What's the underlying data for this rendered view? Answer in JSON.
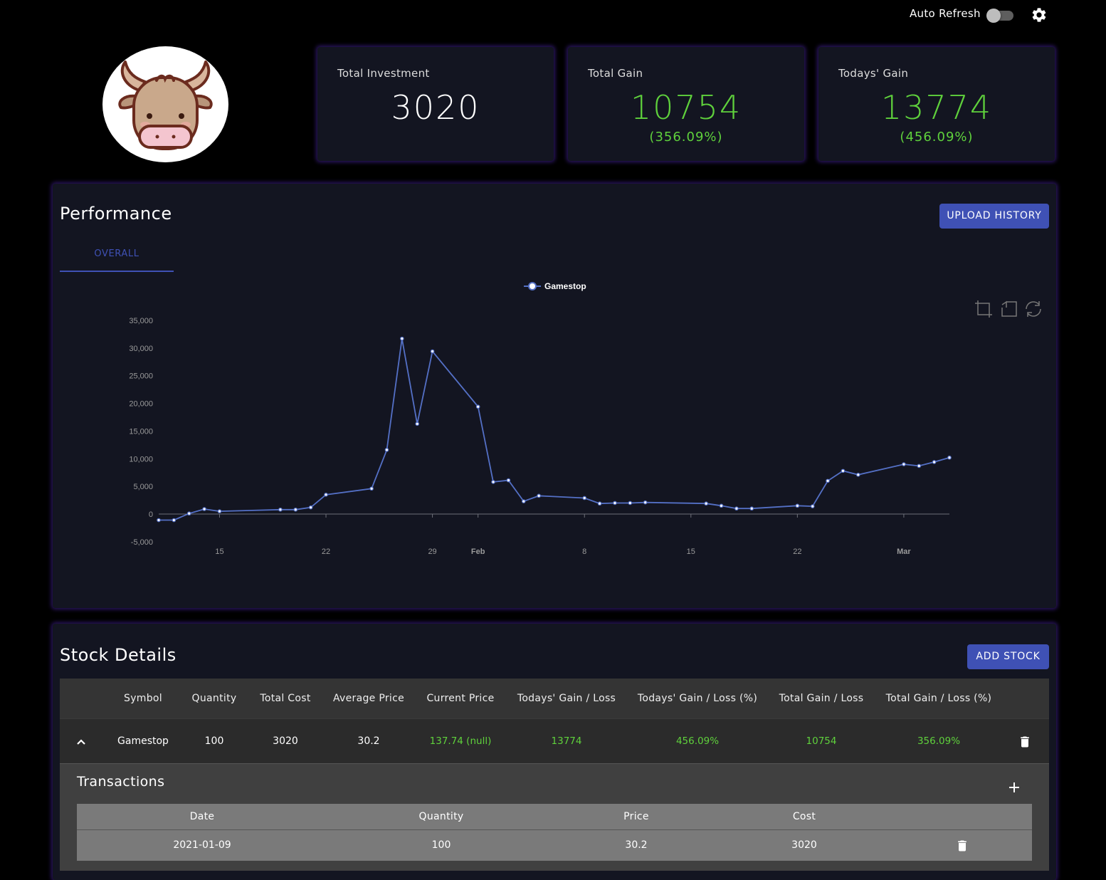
{
  "header": {
    "auto_refresh_label": "Auto Refresh",
    "auto_refresh_on": false,
    "settings_icon": "gear-icon"
  },
  "avatar": {
    "icon": "bull-icon"
  },
  "stats": {
    "total_investment": {
      "title": "Total Investment",
      "value": "3020"
    },
    "total_gain": {
      "title": "Total Gain",
      "value": "10754",
      "percent": "(356.09%)"
    },
    "todays_gain": {
      "title": "Todays' Gain",
      "value": "13774",
      "percent": "(456.09%)"
    }
  },
  "performance": {
    "title": "Performance",
    "upload_button": "UPLOAD HISTORY",
    "tabs": [
      {
        "label": "OVERALL",
        "active": true
      }
    ],
    "toolbar_icons": [
      "zoom-icon",
      "reset-zoom-icon",
      "refresh-icon"
    ]
  },
  "chart_data": {
    "type": "line",
    "series": [
      {
        "name": "Gamestop",
        "color": "#5470c6",
        "points": [
          [
            "2021-01-11",
            -1100
          ],
          [
            "2021-01-12",
            -1100
          ],
          [
            "2021-01-13",
            100
          ],
          [
            "2021-01-14",
            900
          ],
          [
            "2021-01-15",
            500
          ],
          [
            "2021-01-19",
            800
          ],
          [
            "2021-01-20",
            800
          ],
          [
            "2021-01-21",
            1200
          ],
          [
            "2021-01-22",
            3500
          ],
          [
            "2021-01-25",
            4600
          ],
          [
            "2021-01-26",
            11600
          ],
          [
            "2021-01-27",
            31700
          ],
          [
            "2021-01-28",
            16300
          ],
          [
            "2021-01-29",
            29400
          ],
          [
            "2021-02-01",
            19400
          ],
          [
            "2021-02-02",
            5800
          ],
          [
            "2021-02-03",
            6100
          ],
          [
            "2021-02-04",
            2300
          ],
          [
            "2021-02-05",
            3300
          ],
          [
            "2021-02-08",
            2900
          ],
          [
            "2021-02-09",
            1900
          ],
          [
            "2021-02-10",
            2000
          ],
          [
            "2021-02-11",
            2000
          ],
          [
            "2021-02-12",
            2100
          ],
          [
            "2021-02-16",
            1900
          ],
          [
            "2021-02-17",
            1500
          ],
          [
            "2021-02-18",
            1000
          ],
          [
            "2021-02-19",
            1000
          ],
          [
            "2021-02-22",
            1500
          ],
          [
            "2021-02-23",
            1400
          ],
          [
            "2021-02-24",
            6000
          ],
          [
            "2021-02-25",
            7800
          ],
          [
            "2021-02-26",
            7100
          ],
          [
            "2021-03-01",
            9000
          ],
          [
            "2021-03-02",
            8700
          ],
          [
            "2021-03-03",
            9400
          ],
          [
            "2021-03-04",
            10200
          ]
        ]
      }
    ],
    "xlabel": "",
    "ylabel": "",
    "ylim": [
      -5000,
      35000
    ],
    "y_ticks": [
      "35,000",
      "30,000",
      "25,000",
      "20,000",
      "15,000",
      "10,000",
      "5,000",
      "0",
      "-5,000"
    ],
    "x_ticks": [
      {
        "date": "2021-01-15",
        "label": "15",
        "bold": false
      },
      {
        "date": "2021-01-22",
        "label": "22",
        "bold": false
      },
      {
        "date": "2021-01-29",
        "label": "29",
        "bold": false
      },
      {
        "date": "2021-02-01",
        "label": "Feb",
        "bold": true
      },
      {
        "date": "2021-02-08",
        "label": "8",
        "bold": false
      },
      {
        "date": "2021-02-15",
        "label": "15",
        "bold": false
      },
      {
        "date": "2021-02-22",
        "label": "22",
        "bold": false
      },
      {
        "date": "2021-03-01",
        "label": "Mar",
        "bold": true
      }
    ],
    "xlim": [
      "2021-01-11",
      "2021-03-04"
    ],
    "grid": false,
    "legend": "top-center"
  },
  "stock_details": {
    "title": "Stock Details",
    "add_button": "ADD STOCK",
    "columns": [
      "Symbol",
      "Quantity",
      "Total Cost",
      "Average Price",
      "Current Price",
      "Todays' Gain / Loss",
      "Todays' Gain / Loss (%)",
      "Total Gain / Loss",
      "Total Gain / Loss (%)"
    ],
    "rows": [
      {
        "symbol": "Gamestop",
        "quantity": "100",
        "total_cost": "3020",
        "average_price": "30.2",
        "current_price": "137.74 (null)",
        "todays_gain": "13774",
        "todays_gain_pct": "456.09%",
        "total_gain": "10754",
        "total_gain_pct": "356.09%",
        "expanded": true
      }
    ],
    "transactions": {
      "title": "Transactions",
      "columns": [
        "Date",
        "Quantity",
        "Price",
        "Cost"
      ],
      "rows": [
        {
          "date": "2021-01-09",
          "quantity": "100",
          "price": "30.2",
          "cost": "3020"
        }
      ]
    }
  }
}
